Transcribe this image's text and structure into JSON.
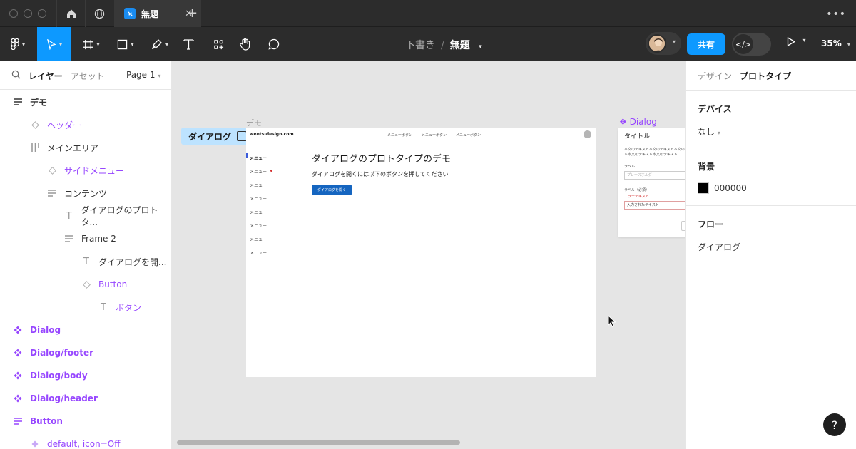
{
  "titlebar": {
    "tab_title": "無題",
    "icons": [
      "home-icon",
      "globe-icon",
      "close-icon",
      "plus-icon",
      "more-icon"
    ]
  },
  "toolbar": {
    "breadcrumb_folder": "下書き",
    "breadcrumb_separator": "/",
    "file_name": "無題",
    "share_label": "共有",
    "dev_mode_icon": "</>",
    "zoom_label": "35%",
    "tools": [
      "figma-menu-icon",
      "move-tool-icon",
      "frame-tool-icon",
      "rectangle-tool-icon",
      "pen-tool-icon",
      "text-tool-icon",
      "resources-icon",
      "hand-tool-icon",
      "comment-tool-icon"
    ],
    "accent_color": "#0d99ff"
  },
  "left_panel": {
    "tab_layers": "レイヤー",
    "tab_assets": "アセット",
    "page_label": "Page 1",
    "layers": [
      {
        "label": "デモ",
        "kind": "frame"
      },
      {
        "label": "ヘッダー",
        "kind": "instance"
      },
      {
        "label": "メインエリア",
        "kind": "auto-layout-h"
      },
      {
        "label": "サイドメニュー",
        "kind": "instance"
      },
      {
        "label": "コンテンツ",
        "kind": "auto-layout"
      },
      {
        "label": "ダイアログのプロトタ...",
        "kind": "text"
      },
      {
        "label": "Frame 2",
        "kind": "auto-layout"
      },
      {
        "label": "ダイアログを開...",
        "kind": "text"
      },
      {
        "label": "Button",
        "kind": "instance"
      },
      {
        "label": "ボタン",
        "kind": "text"
      },
      {
        "label": "Dialog",
        "kind": "component"
      },
      {
        "label": "Dialog/footer",
        "kind": "component"
      },
      {
        "label": "Dialog/body",
        "kind": "component"
      },
      {
        "label": "Dialog/header",
        "kind": "component"
      },
      {
        "label": "Button",
        "kind": "component-set"
      },
      {
        "label": "default, icon=Off",
        "kind": "variant"
      }
    ]
  },
  "right_panel": {
    "tab_design": "デザイン",
    "tab_prototype": "プロトタイプ",
    "device_title": "デバイス",
    "device_value": "なし",
    "background_title": "背景",
    "background_value": "000000",
    "background_color": "#000000",
    "flow_title": "フロー",
    "flow_value": "ダイアログ",
    "help_label": "?"
  },
  "canvas": {
    "frame_name": "デモ",
    "flow_chip": "ダイアログ",
    "demo": {
      "logo": "wents-design.com",
      "nav": [
        "メニューボタン",
        "メニューボタン",
        "メニューボタン"
      ],
      "menu": [
        "メニュー",
        "メニュー",
        "メニュー",
        "メニュー",
        "メニュー",
        "メニュー",
        "メニュー",
        "メニュー"
      ],
      "heading": "ダイアログのプロトタイプのデモ",
      "paragraph": "ダイアログを開くには以下のボタンを押してください",
      "button": "ダイアログを開く"
    },
    "dialog": {
      "component_label": "Dialog",
      "title": "タイトル",
      "body": "本文のテキスト本文のテキスト本文のテキスト本文のテキスト本文のテキスト",
      "label1": "ラベル",
      "placeholder": "プレースホルダ",
      "label2": "ラベル（必須）",
      "error": "エラーテキスト",
      "input_value": "入力されたテキスト"
    }
  }
}
